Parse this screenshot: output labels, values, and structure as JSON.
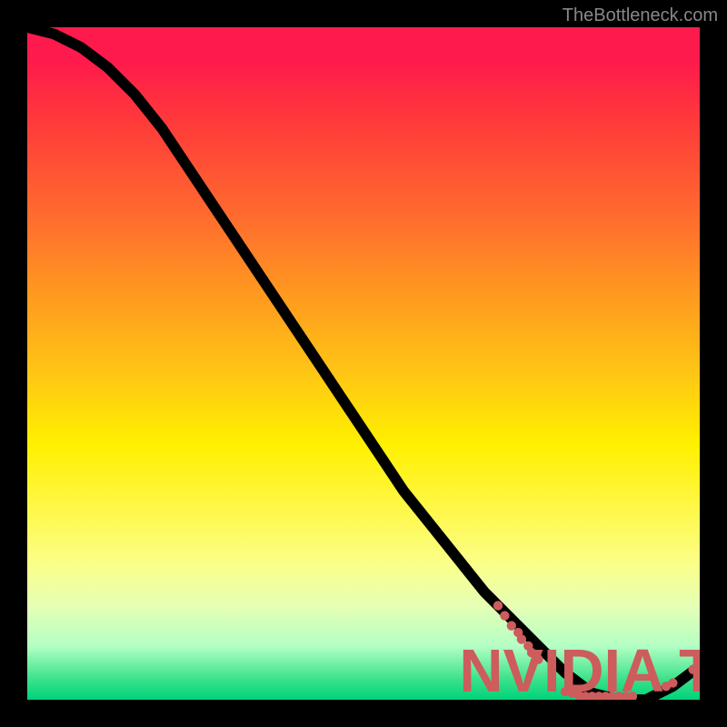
{
  "watermark": "TheBottleneck.com",
  "colors": {
    "background": "#000000",
    "gradient_top": "#ff1a4d",
    "gradient_bottom": "#00d27a",
    "curve": "#000000",
    "dots": "#cd5c5c"
  },
  "chart_data": {
    "type": "line",
    "title": "",
    "xlabel": "",
    "ylabel": "",
    "xlim": [
      0,
      100
    ],
    "ylim": [
      0,
      100
    ],
    "series": [
      {
        "name": "curve",
        "x": [
          0,
          4,
          8,
          12,
          16,
          20,
          24,
          28,
          32,
          36,
          40,
          44,
          48,
          52,
          56,
          60,
          64,
          68,
          72,
          76,
          80,
          84,
          88,
          92,
          96,
          100
        ],
        "y": [
          100,
          99,
          97,
          94,
          90,
          85,
          79,
          73,
          67,
          61,
          55,
          49,
          43,
          37,
          31,
          26,
          21,
          16,
          12,
          8,
          4,
          1,
          0,
          0,
          2,
          5
        ]
      }
    ],
    "scatter": [
      {
        "x": 70.0,
        "y": 14.0
      },
      {
        "x": 71.0,
        "y": 12.5
      },
      {
        "x": 72.0,
        "y": 11.0
      },
      {
        "x": 73.0,
        "y": 10.0
      },
      {
        "x": 73.5,
        "y": 9.0
      },
      {
        "x": 74.5,
        "y": 8.0
      },
      {
        "x": 75.0,
        "y": 7.0
      },
      {
        "x": 76.0,
        "y": 6.0
      },
      {
        "x": 80.0,
        "y": 1.2
      },
      {
        "x": 81.0,
        "y": 1.0
      },
      {
        "x": 82.0,
        "y": 0.7
      },
      {
        "x": 83.0,
        "y": 0.5
      },
      {
        "x": 84.0,
        "y": 0.5
      },
      {
        "x": 85.0,
        "y": 0.5
      },
      {
        "x": 86.0,
        "y": 0.5
      },
      {
        "x": 87.0,
        "y": 0.5
      },
      {
        "x": 88.0,
        "y": 0.5
      },
      {
        "x": 89.0,
        "y": 0.5
      },
      {
        "x": 90.0,
        "y": 0.5
      },
      {
        "x": 95.0,
        "y": 2.0
      },
      {
        "x": 96.0,
        "y": 2.5
      },
      {
        "x": 99.0,
        "y": 4.5
      },
      {
        "x": 100.0,
        "y": 5.5
      }
    ],
    "point_label": {
      "text": "NVIDIA Ti",
      "x": 84.5,
      "y": 1.2
    }
  }
}
